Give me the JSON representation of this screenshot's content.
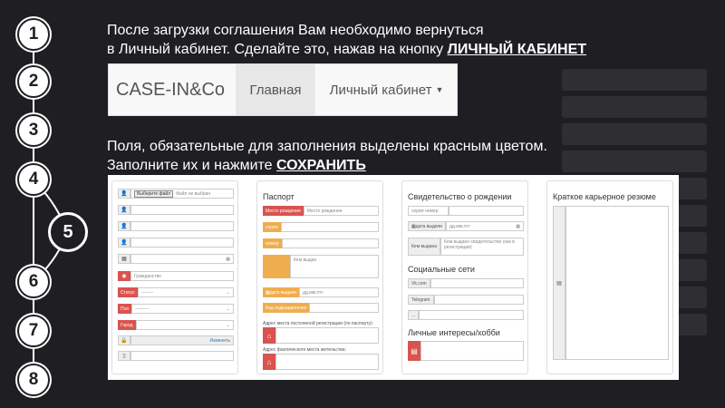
{
  "steps": [
    "1",
    "2",
    "3",
    "4",
    "5",
    "6",
    "7",
    "8"
  ],
  "instruction1": {
    "line1": "После загрузки соглашения Вам необходимо вернуться",
    "line2_prefix": "в Личный кабинет. Сделайте это, нажав на кнопку ",
    "line2_link": "ЛИЧНЫЙ КАБИНЕТ"
  },
  "navbar": {
    "brand": "CASE-IN&Co",
    "home": "Главная",
    "cabinet": "Личный кабинет"
  },
  "instruction2": {
    "line1": "Поля, обязательные для заполнения выделены красным цветом.",
    "line2_prefix": "Заполните их и нажмите ",
    "line2_link": "СОХРАНИТЬ"
  },
  "colors": {
    "required": "#d9534f",
    "warning": "#f0ad4e"
  },
  "form": {
    "col1": {
      "file_button": "Выберите файл",
      "file_status": "Файл не выбран",
      "citizenship_placeholder": "Гражданство",
      "status_label": "Статус",
      "status_value": "--------",
      "gender_label": "Пол",
      "gender_value": "---------",
      "city_label": "Город",
      "change_button": "Изменить"
    },
    "col2": {
      "title": "Паспорт",
      "birthplace_label": "Место рождения",
      "birthplace_placeholder": "Место рождения",
      "series_label": "серия",
      "number_label": "номер",
      "issued_by_placeholder": "Кем выдан",
      "issue_date_label": "дата выдачи",
      "date_placeholder": "дд.мм.гггг",
      "dept_code_label": "Код подразделения",
      "reg_address_label": "Адрес места постоянной регистрации (по паспорту):",
      "actual_address_label": "Адрес фактического места жительства:"
    },
    "col3": {
      "title": "Свидетельство о рождении",
      "series_number_placeholder": "серия номер",
      "issue_date_label": "дата выдачи",
      "date_placeholder": "дд.мм.гггг",
      "issued_by_label": "Кем выдана",
      "issued_by_placeholder": "Кем выдано свидетельство (как в регистрации)",
      "social_title": "Социальные сети",
      "vk_label": "Vk.com",
      "telegram_label": "Telegram",
      "other_label": "...",
      "hobby_title": "Личные интересы/хобби"
    },
    "col4": {
      "title": "Краткое карьерное резюме"
    }
  }
}
